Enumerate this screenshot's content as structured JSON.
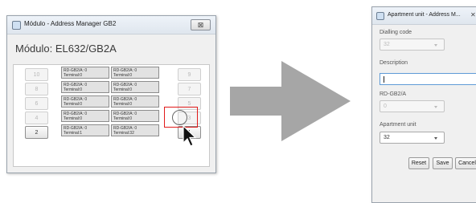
{
  "left_window": {
    "title": "Módulo - Address Manager GB2",
    "close_glyph": "⊠",
    "heading": "Módulo:  EL632/GB2A",
    "left_buttons": [
      "10",
      "8",
      "6",
      "4",
      "2"
    ],
    "right_buttons": [
      "9",
      "7",
      "5",
      "3",
      "1"
    ],
    "grid": [
      [
        {
          "line1": "RD-GB2/A: 0",
          "line2": "Terminal:0"
        },
        {
          "line1": "RD-GB2/A: 0",
          "line2": "Terminal:0"
        }
      ],
      [
        {
          "line1": "RD-GB2/A: 0",
          "line2": "Terminal:0"
        },
        {
          "line1": "RD-GB2/A: 0",
          "line2": "Terminal:0"
        }
      ],
      [
        {
          "line1": "RD-GB2/A: 0",
          "line2": "Terminal:0"
        },
        {
          "line1": "RD-GB2/A: 0",
          "line2": "Terminal:0"
        }
      ],
      [
        {
          "line1": "RD-GB2/A: 0",
          "line2": "Terminal:0"
        },
        {
          "line1": "RD-GB2/A: 0",
          "line2": "Terminal:0"
        }
      ],
      [
        {
          "line1": "RD-GB2/A: 0",
          "line2": "Terminal:1"
        },
        {
          "line1": "RD-GB2/A: 0",
          "line2": "Terminal:32"
        }
      ]
    ]
  },
  "right_window": {
    "title": "Apartment unit - Address M...",
    "close_glyph": "✕",
    "dialling_code_label": "Dialling code",
    "dialling_code_value": "32",
    "description_label": "Description",
    "description_value": "",
    "rd_label": "RD-GB2/A",
    "rd_value": "0",
    "apartment_label": "Apartment unit",
    "apartment_value": "32",
    "reset_label": "Reset",
    "save_label": "Save",
    "cancel_label": "Cancel"
  },
  "colors": {
    "arrow": "#a6a6a6",
    "highlight": "#e11b1b"
  }
}
